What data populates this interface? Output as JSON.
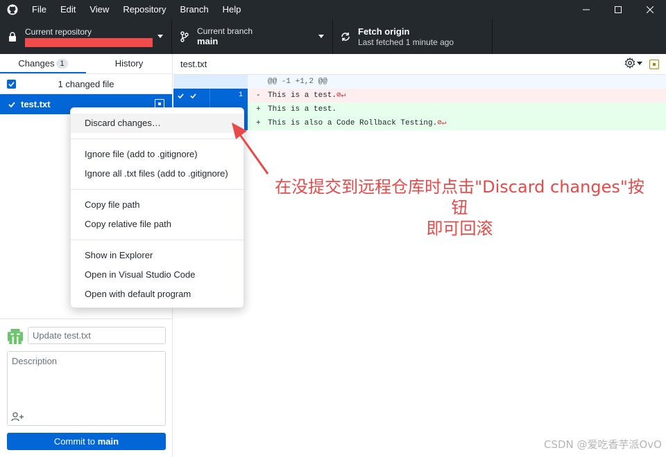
{
  "menu": [
    "File",
    "Edit",
    "View",
    "Repository",
    "Branch",
    "Help"
  ],
  "toolbar": {
    "repo_label": "Current repository",
    "branch_label": "Current branch",
    "branch_value": "main",
    "fetch_label": "Fetch origin",
    "fetch_sub": "Last fetched 1 minute ago"
  },
  "sidebar": {
    "tab_changes": "Changes",
    "tab_changes_count": "1",
    "tab_history": "History",
    "changed_count": "1 changed file",
    "file_name": "test.txt"
  },
  "commit": {
    "summary_placeholder": "Update test.txt",
    "description_placeholder": "Description",
    "button_prefix": "Commit to ",
    "button_branch": "main"
  },
  "diff": {
    "file": "test.txt",
    "hunk": "@@ -1 +1,2 @@",
    "line_number": "1",
    "lines": [
      {
        "marker": "-",
        "text": "This is a test."
      },
      {
        "marker": "+",
        "text": "This is a test."
      },
      {
        "marker": "+",
        "text": "This is also a Code Rollback Testing."
      }
    ]
  },
  "context_menu": {
    "discard": "Discard changes…",
    "ignore_file": "Ignore file (add to .gitignore)",
    "ignore_all": "Ignore all .txt files (add to .gitignore)",
    "copy_path": "Copy file path",
    "copy_relative": "Copy relative file path",
    "show_explorer": "Show in Explorer",
    "open_vscode": "Open in Visual Studio Code",
    "open_default": "Open with default program"
  },
  "annotation": {
    "line1": "在没提交到远程仓库时点击\"Discard changes\"按钮",
    "line2": "即可回滚"
  },
  "watermark": "CSDN @爱吃香芋派OvO",
  "colors": {
    "accent": "#0366d6",
    "titlebar": "#24292e",
    "annotation": "#e84a4a",
    "redaction": "#f24b4b"
  }
}
